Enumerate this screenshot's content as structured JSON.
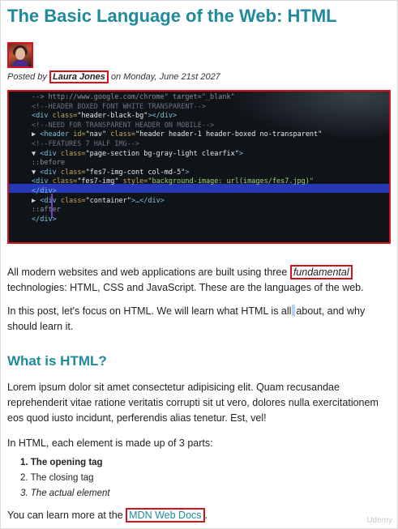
{
  "article": {
    "title": "The Basic Language of the Web: HTML",
    "byline_prefix": "Posted by ",
    "author": "Laura Jones",
    "byline_suffix": " on Monday, June 21st 2027"
  },
  "code_image": {
    "lines": [
      {
        "parts": [
          {
            "t": "  -->",
            "c": "c-dim"
          },
          {
            "t": "  http://www.google.com/chrome\" target=\"_blank\"",
            "c": "c-dim"
          }
        ]
      },
      {
        "parts": [
          {
            "t": "  <!--HEADER BOXED FONT WHITE TRANSPARENT-->",
            "c": "c-com"
          }
        ]
      },
      {
        "parts": [
          {
            "t": "  <div ",
            "c": "c-tag"
          },
          {
            "t": "class=",
            "c": "c-attr"
          },
          {
            "t": "\"header-black-bg\"",
            "c": "c-val"
          },
          {
            "t": "></div>",
            "c": "c-tag"
          }
        ]
      },
      {
        "parts": [
          {
            "t": "  <!--NEED FOR TRANSPARENT HEADER ON MOBILE-->",
            "c": "c-com"
          }
        ]
      },
      {
        "parts": [
          {
            "t": "▶ ",
            "c": "c-arr"
          },
          {
            "t": "<header ",
            "c": "c-tag"
          },
          {
            "t": "id=",
            "c": "c-attr"
          },
          {
            "t": "\"nav\" ",
            "c": "c-val"
          },
          {
            "t": "class=",
            "c": "c-attr"
          },
          {
            "t": "\"header header-1 header-boxed no-transparent\"",
            "c": "c-val"
          }
        ]
      },
      {
        "parts": [
          {
            "t": "  <!--FEATURES 7 HALF IMG-->",
            "c": "c-com"
          }
        ]
      },
      {
        "parts": [
          {
            "t": "▼ ",
            "c": "c-arr"
          },
          {
            "t": "<div ",
            "c": "c-tag"
          },
          {
            "t": "class=",
            "c": "c-attr"
          },
          {
            "t": "\"page-section bg-gray-light clearfix\"",
            "c": "c-val"
          },
          {
            "t": ">",
            "c": "c-tag"
          }
        ]
      },
      {
        "parts": [
          {
            "t": "    ::before",
            "c": "c-dim"
          }
        ]
      },
      {
        "parts": [
          {
            "t": "  ▼ ",
            "c": "c-arr"
          },
          {
            "t": "<div ",
            "c": "c-tag"
          },
          {
            "t": "class=",
            "c": "c-attr"
          },
          {
            "t": "\"fes7-img-cont col-md-5\"",
            "c": "c-val"
          },
          {
            "t": ">",
            "c": "c-tag"
          }
        ]
      },
      {
        "parts": [
          {
            "t": "      <div ",
            "c": "c-tag"
          },
          {
            "t": "class=",
            "c": "c-attr"
          },
          {
            "t": "\"fes7-img\" ",
            "c": "c-val"
          },
          {
            "t": "style=",
            "c": "c-attr"
          },
          {
            "t": "\"background-image: url(images/fes7.jpg)\"",
            "c": "c-str"
          }
        ]
      },
      {
        "parts": [
          {
            "t": "      </div>",
            "c": "c-tag"
          }
        ]
      },
      {
        "parts": [
          {
            "t": "  ▶ ",
            "c": "c-arr"
          },
          {
            "t": "<div ",
            "c": "c-tag"
          },
          {
            "t": "class=",
            "c": "c-attr"
          },
          {
            "t": "\"container\"",
            "c": "c-val"
          },
          {
            "t": ">…</div>",
            "c": "c-tag"
          }
        ]
      },
      {
        "parts": [
          {
            "t": "    ::after",
            "c": "c-dim"
          }
        ]
      },
      {
        "parts": [
          {
            "t": "  </div>",
            "c": "c-tag"
          }
        ]
      }
    ]
  },
  "body": {
    "p1_before": "All modern websites and web applications are built using three ",
    "p1_highlight": "fundamental",
    "p1_after": " technologies: HTML, CSS and JavaScript. These are the languages of the web.",
    "p2_before": "In this post, let's focus on HTML. We will learn what HTML is all",
    "p2_after": "about, and why should learn it.",
    "h2": "What is HTML?",
    "p3": "Lorem ipsum dolor sit amet consectetur adipisicing elit. Quam recusandae reprehenderit vitae ratione veritatis corrupti sit ut vero, dolores nulla exercitationem eos quod iusto incidunt, perferendis alias tenetur. Est, vel!",
    "p4": "In HTML, each element is made up of 3 parts:",
    "list": [
      "1. The opening tag",
      "2. The closing tag",
      "3. The actual element"
    ],
    "p5_before": "You can learn more at the ",
    "p5_link": "MDN Web Docs",
    "p5_after": "."
  },
  "watermark": "Udemy"
}
